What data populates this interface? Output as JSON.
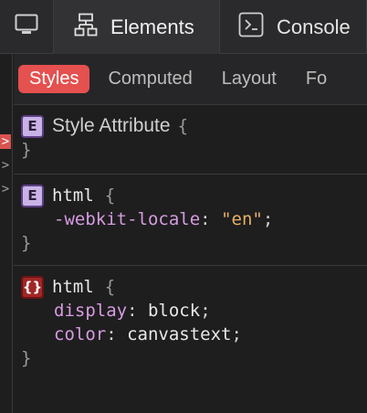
{
  "toolbar": {
    "tabs": [
      {
        "label": "",
        "icon": "monitor-icon"
      },
      {
        "label": "Elements",
        "icon": "elements-tree-icon"
      },
      {
        "label": "Console",
        "icon": "console-prompt-icon"
      }
    ]
  },
  "gutter": {
    "marks": [
      ">",
      ">",
      ">"
    ]
  },
  "styles_panel": {
    "subtabs": [
      "Styles",
      "Computed",
      "Layout",
      "Fo"
    ],
    "rules": [
      {
        "badge": "E",
        "selector": "Style Attribute",
        "open": "{",
        "close": "}",
        "declarations": []
      },
      {
        "badge": "E",
        "selector": "html",
        "open": "{",
        "close": "}",
        "declarations": [
          {
            "property": "-webkit-locale",
            "colon": ":",
            "value": "\"en\"",
            "semi": ";"
          }
        ]
      },
      {
        "badge": "{}",
        "selector": "html",
        "open": "{",
        "close": "}",
        "declarations": [
          {
            "property": "display",
            "colon": ":",
            "value": "block",
            "semi": ";"
          },
          {
            "property": "color",
            "colon": ":",
            "value": "canvastext",
            "semi": ";"
          }
        ]
      }
    ]
  },
  "colors": {
    "accent": "#e4514f",
    "property": "#d79be0",
    "string": "#e8b163"
  }
}
